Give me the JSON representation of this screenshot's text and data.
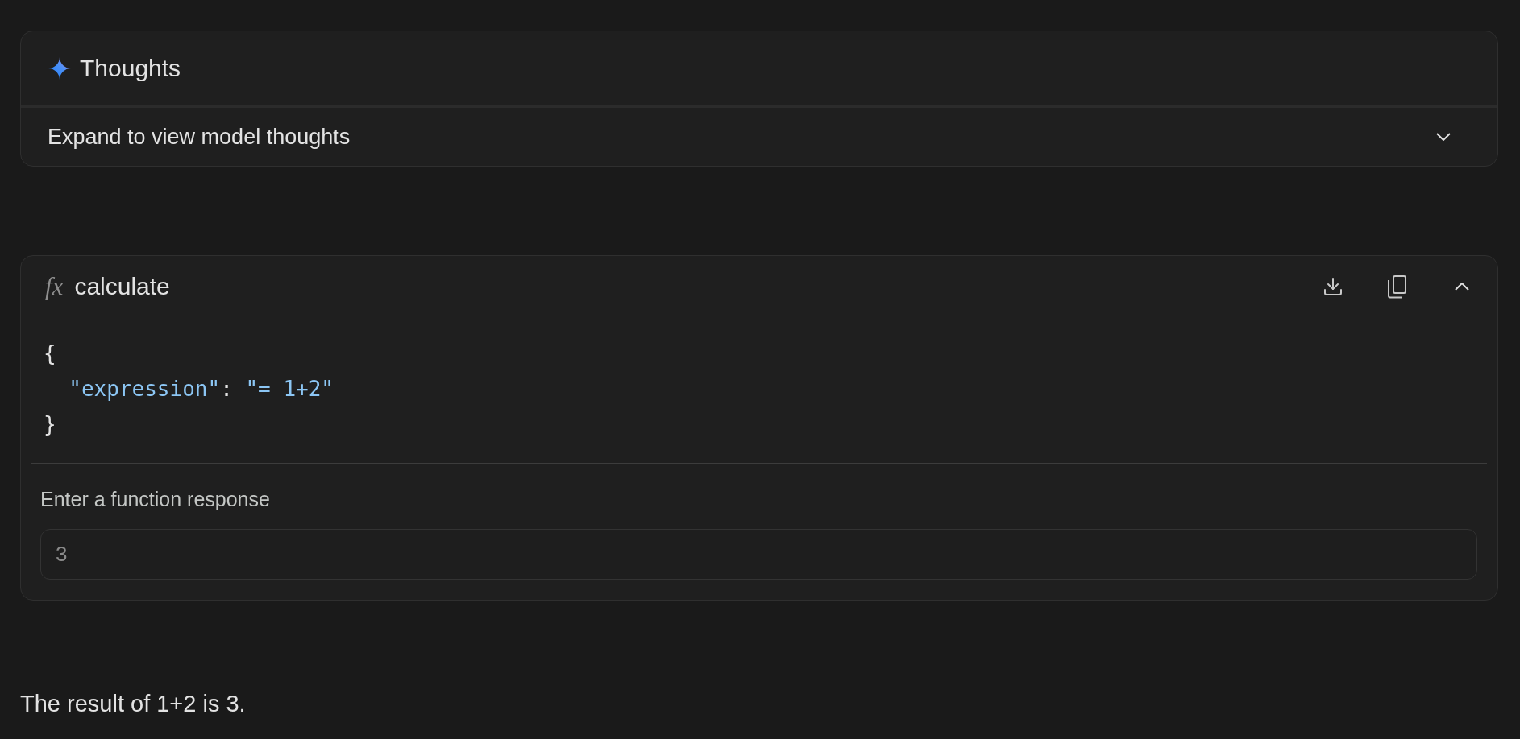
{
  "thoughts_panel": {
    "title": "Thoughts",
    "toggle_label": "Expand to view model thoughts",
    "expanded": false
  },
  "function_call": {
    "icon_text": "fx",
    "name": "calculate",
    "expanded": true,
    "arguments_code": [
      {
        "tokens": [
          {
            "kind": "punctuation",
            "text": "{"
          }
        ],
        "children": [
          {
            "tokens": [
              {
                "kind": "key",
                "text": "\"expression\""
              },
              {
                "kind": "punctuation",
                "text": ": "
              },
              {
                "kind": "string",
                "text": "\"= 1+2\""
              }
            ]
          }
        ]
      },
      {
        "tokens": [
          {
            "kind": "punctuation",
            "text": "}"
          }
        ]
      }
    ],
    "response": {
      "label": "Enter a function response",
      "value": "3",
      "disabled": true
    }
  },
  "answer_text": "The result of 1+2 is 3."
}
